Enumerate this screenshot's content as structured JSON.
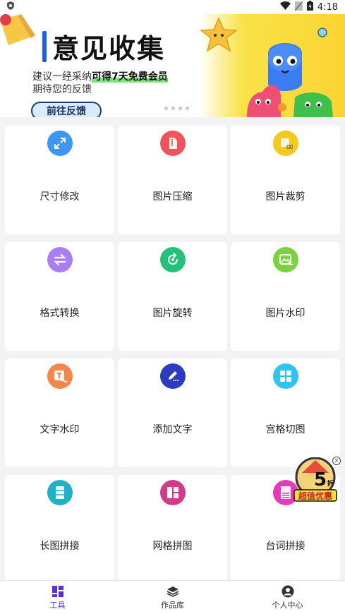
{
  "status": {
    "time": "4:18"
  },
  "banner": {
    "title": "意见收集",
    "line1_prefix": "建议一经采纳",
    "line1_highlight": "可得7天免费会员",
    "line2": "期待您的反馈",
    "button": "前往反馈"
  },
  "tools": [
    {
      "label": "尺寸修改",
      "icon": "resize-icon",
      "color": "#3d95f5"
    },
    {
      "label": "图片压缩",
      "icon": "zip-file-icon",
      "color": "#f0545a"
    },
    {
      "label": "图片裁剪",
      "icon": "crop-icon",
      "color": "#f5c91c"
    },
    {
      "label": "格式转换",
      "icon": "convert-arrows-icon",
      "color": "#a97ef3"
    },
    {
      "label": "图片旋转",
      "icon": "rotate-icon",
      "color": "#23c17a"
    },
    {
      "label": "图片水印",
      "icon": "image-watermark-icon",
      "color": "#7bd23e"
    },
    {
      "label": "文字水印",
      "icon": "text-watermark-icon",
      "color": "#f7844a"
    },
    {
      "label": "添加文字",
      "icon": "pen-icon",
      "color": "#2b3bc2"
    },
    {
      "label": "宫格切图",
      "icon": "grid-icon",
      "color": "#2ec4ef"
    },
    {
      "label": "长图拼接",
      "icon": "long-image-icon",
      "color": "#1fb1c8"
    },
    {
      "label": "网格拼图",
      "icon": "collage-icon",
      "color": "#d43a8a"
    },
    {
      "label": "台词拼接",
      "icon": "subtitle-icon",
      "color": "#e33bb9"
    }
  ],
  "promo": {
    "big": "5",
    "unit": "折",
    "text": "超值优惠"
  },
  "tabbar": {
    "items": [
      {
        "label": "工具",
        "icon": "tools-icon",
        "active": true
      },
      {
        "label": "作品库",
        "icon": "layers-icon",
        "active": false
      },
      {
        "label": "个人中心",
        "icon": "user-icon",
        "active": false
      }
    ]
  },
  "colors": {
    "accent": "#5b2fd8",
    "background": "#f3f3f5"
  }
}
